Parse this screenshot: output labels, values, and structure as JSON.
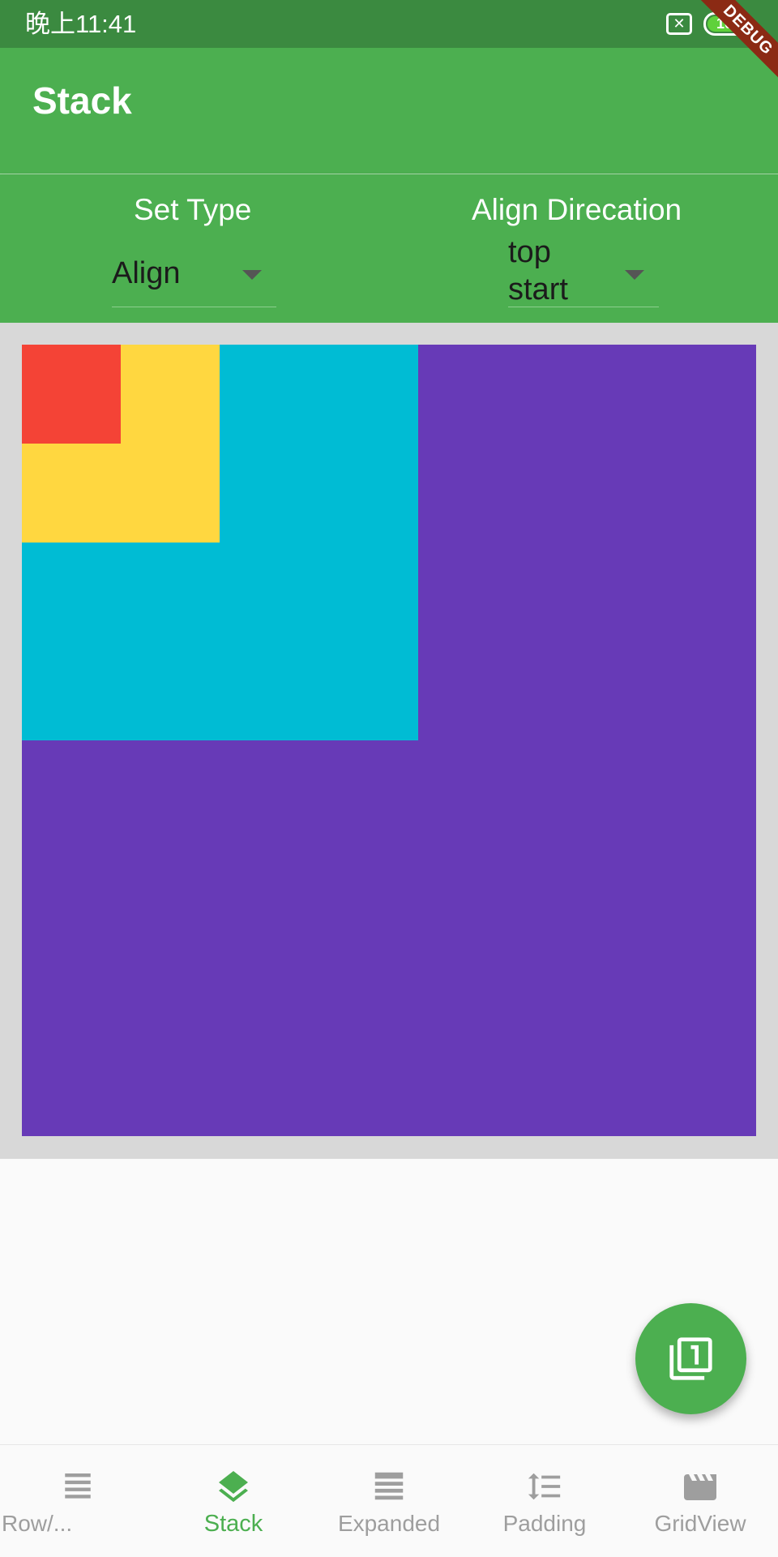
{
  "status_bar": {
    "time": "晚上11:41",
    "sim_icon_label": "✕",
    "battery_level": "100"
  },
  "debug_banner": {
    "label": "DEBUG"
  },
  "app_bar": {
    "title": "Stack"
  },
  "controls": {
    "set_type": {
      "label": "Set Type",
      "value": "Align"
    },
    "align_direction": {
      "label": "Align Direcation",
      "value_line1": "top",
      "value_line2": "start"
    }
  },
  "stack": {
    "boxes": [
      {
        "name": "purple",
        "color": "#673ab7"
      },
      {
        "name": "cyan",
        "color": "#00bcd4"
      },
      {
        "name": "yellow",
        "color": "#ffd740"
      },
      {
        "name": "red",
        "color": "#f44336"
      }
    ]
  },
  "fab": {
    "icon": "filter-1-icon"
  },
  "bottom_nav": {
    "items": [
      {
        "label": "Row/...",
        "icon": "menu-lines-icon",
        "active": false
      },
      {
        "label": "Stack",
        "icon": "layers-icon",
        "active": true
      },
      {
        "label": "Expanded",
        "icon": "view-headline-icon",
        "active": false
      },
      {
        "label": "Padding",
        "icon": "format-line-spacing-icon",
        "active": false
      },
      {
        "label": "GridView",
        "icon": "movie-icon",
        "active": false
      }
    ]
  },
  "colors": {
    "primary": "#4caf50",
    "status_bar": "#3b8a40",
    "inactive_nav": "#9e9e9e"
  }
}
